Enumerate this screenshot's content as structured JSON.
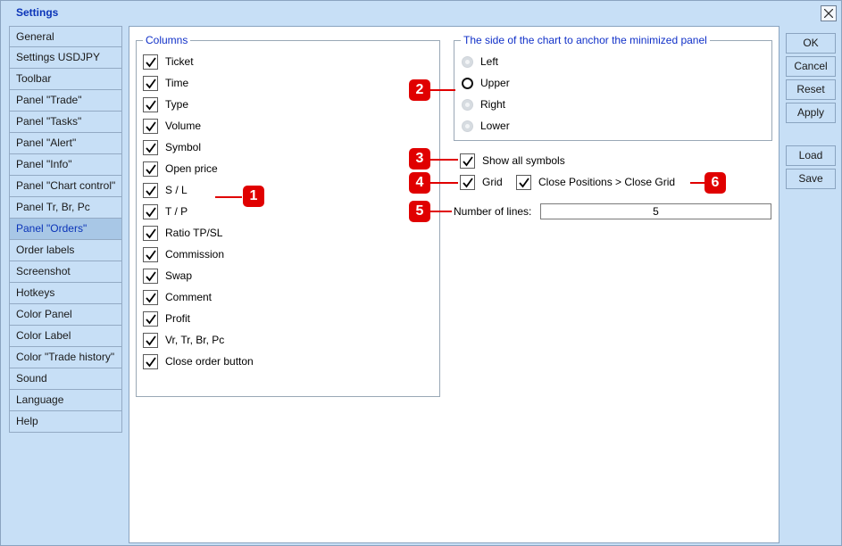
{
  "window": {
    "title": "Settings"
  },
  "sidebar": {
    "items": [
      {
        "label": "General"
      },
      {
        "label": "Settings USDJPY"
      },
      {
        "label": "Toolbar"
      },
      {
        "label": "Panel \"Trade\""
      },
      {
        "label": "Panel \"Tasks\""
      },
      {
        "label": "Panel \"Alert\""
      },
      {
        "label": "Panel \"Info\""
      },
      {
        "label": "Panel \"Chart control\""
      },
      {
        "label": "Panel Tr, Br, Pc"
      },
      {
        "label": "Panel \"Orders\"",
        "active": true
      },
      {
        "label": "Order labels"
      },
      {
        "label": "Screenshot"
      },
      {
        "label": "Hotkeys"
      },
      {
        "label": "Color Panel"
      },
      {
        "label": "Color Label"
      },
      {
        "label": "Color \"Trade history\""
      },
      {
        "label": "Sound"
      },
      {
        "label": "Language"
      },
      {
        "label": "Help"
      }
    ]
  },
  "columns": {
    "title": "Columns",
    "items": [
      {
        "label": "Ticket",
        "checked": true
      },
      {
        "label": "Time",
        "checked": true
      },
      {
        "label": "Type",
        "checked": true
      },
      {
        "label": "Volume",
        "checked": true
      },
      {
        "label": "Symbol",
        "checked": true
      },
      {
        "label": "Open price",
        "checked": true
      },
      {
        "label": "S / L",
        "checked": true
      },
      {
        "label": "T / P",
        "checked": true
      },
      {
        "label": "Ratio TP/SL",
        "checked": true
      },
      {
        "label": "Commission",
        "checked": true
      },
      {
        "label": "Swap",
        "checked": true
      },
      {
        "label": "Comment",
        "checked": true
      },
      {
        "label": "Profit",
        "checked": true
      },
      {
        "label": "Vr, Tr, Br, Pc",
        "checked": true
      },
      {
        "label": "Close order button",
        "checked": true
      }
    ]
  },
  "anchor": {
    "title": "The side of the chart to anchor the minimized panel",
    "options": [
      {
        "label": "Left",
        "selected": false
      },
      {
        "label": "Upper",
        "selected": true
      },
      {
        "label": "Right",
        "selected": false
      },
      {
        "label": "Lower",
        "selected": false
      }
    ]
  },
  "options": {
    "show_all_symbols": {
      "label": "Show all symbols",
      "checked": true
    },
    "grid": {
      "label": "Grid",
      "checked": true
    },
    "close_positions": {
      "label": "Close Positions > Close Grid",
      "checked": true
    },
    "number_of_lines": {
      "label": "Number of lines:",
      "value": "5"
    }
  },
  "buttons": {
    "ok": "OK",
    "cancel": "Cancel",
    "reset": "Reset",
    "apply": "Apply",
    "load": "Load",
    "save": "Save"
  },
  "markers": [
    "1",
    "2",
    "3",
    "4",
    "5",
    "6"
  ],
  "colors": {
    "accent": "#0b34b8",
    "marker": "#e00000",
    "background": "#c7dff6"
  }
}
